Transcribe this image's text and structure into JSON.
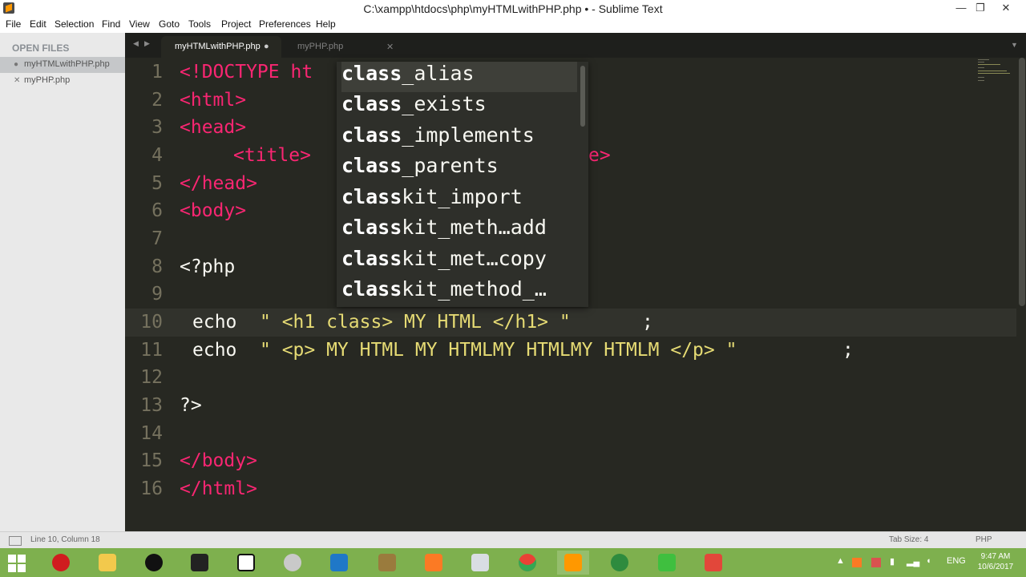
{
  "window": {
    "title": "C:\\xampp\\htdocs\\php\\myHTMLwithPHP.php • - Sublime Text",
    "controls": {
      "minimize": "—",
      "maximize": "❐",
      "close": "✕"
    }
  },
  "menu": [
    "File",
    "Edit",
    "Selection",
    "Find",
    "View",
    "Goto",
    "Tools",
    "Project",
    "Preferences",
    "Help"
  ],
  "sidebar": {
    "header": "OPEN FILES",
    "items": [
      {
        "label": "myHTMLwithPHP.php",
        "mark": "●",
        "active": true
      },
      {
        "label": "myPHP.php",
        "mark": "✕",
        "active": false
      }
    ]
  },
  "tabs": [
    {
      "label": "myHTMLwithPHP.php",
      "indicator": "●",
      "active": true
    },
    {
      "label": "myPHP.php",
      "indicator": "✕",
      "active": false
    }
  ],
  "tab_nav": {
    "prev": "◀",
    "next": "▶",
    "dropdown": "▼"
  },
  "editor": {
    "line_numbers": [
      "1",
      "2",
      "3",
      "4",
      "5",
      "6",
      "7",
      "8",
      "9",
      "10",
      "11",
      "12",
      "13",
      "14",
      "15",
      "16"
    ],
    "lines": {
      "l1": "<!DOCTYPE ht",
      "l2": "<html>",
      "l3": "<head>",
      "l4a": "<title>",
      "l4b": "e>",
      "l5": "</head>",
      "l6": "<body>",
      "l8": "<?php",
      "l10a": "echo ",
      "l10b": "\" <h1 class> MY HTML </h1> \"",
      "l10c": ";",
      "l11a": "echo ",
      "l11b": "\" <p> MY HTML MY HTMLMY HTMLMY HTMLM </p> \"",
      "l11c": ";",
      "l13": "?>",
      "l15": "</body>",
      "l16": "</html>"
    }
  },
  "autocomplete": {
    "items": [
      {
        "match": "class",
        "rest": "_alias"
      },
      {
        "match": "class",
        "rest": "_exists"
      },
      {
        "match": "class",
        "rest": "_implements"
      },
      {
        "match": "class",
        "rest": "_parents"
      },
      {
        "match": "class",
        "rest": "kit_import"
      },
      {
        "match": "class",
        "rest": "kit_meth…add"
      },
      {
        "match": "class",
        "rest": "kit_met…copy"
      },
      {
        "match": "class",
        "rest": "kit_method_…"
      }
    ],
    "selected_index": 0
  },
  "statusbar": {
    "position": "Line 10, Column 18",
    "tab_size": "Tab Size: 4",
    "syntax": "PHP"
  },
  "taskbar": {
    "apps": [
      "opera-icon",
      "file-explorer-icon",
      "github-icon",
      "intellij-icon",
      "jetbrains-icon",
      "paint-icon",
      "outlook-icon",
      "archive-icon",
      "xampp-icon",
      "media-icon",
      "chrome-icon",
      "sublime-icon",
      "internet-download-icon",
      "camtasia-icon",
      "brackets-icon"
    ],
    "language": "ENG",
    "time": "9:47 AM",
    "date": "10/6/2017"
  },
  "colors": {
    "editor_bg": "#272822",
    "tag": "#f92672",
    "string": "#e6db74",
    "line_number": "#75715e",
    "taskbar": "#7eb04e"
  }
}
